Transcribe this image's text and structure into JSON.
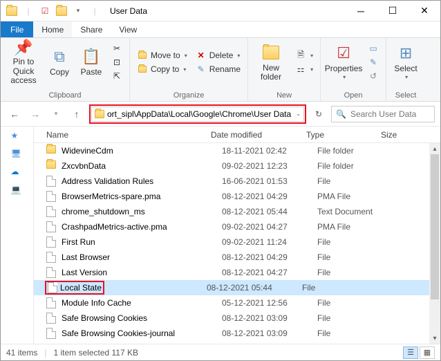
{
  "window": {
    "title": "User Data"
  },
  "menu": {
    "file": "File",
    "home": "Home",
    "share": "Share",
    "view": "View"
  },
  "ribbon": {
    "clipboard": {
      "label": "Clipboard",
      "pin": "Pin to Quick\naccess",
      "copy": "Copy",
      "paste": "Paste"
    },
    "organize": {
      "label": "Organize",
      "moveto": "Move to",
      "copyto": "Copy to",
      "delete": "Delete",
      "rename": "Rename"
    },
    "new": {
      "label": "New",
      "newfolder": "New\nfolder"
    },
    "open": {
      "label": "Open",
      "properties": "Properties"
    },
    "select": {
      "label": "Select",
      "select": "Select"
    }
  },
  "address": {
    "path": "ort_sipl\\AppData\\Local\\Google\\Chrome\\User Data"
  },
  "search": {
    "placeholder": "Search User Data"
  },
  "columns": {
    "name": "Name",
    "date": "Date modified",
    "type": "Type",
    "size": "Size"
  },
  "files": [
    {
      "icon": "folder",
      "name": "WidevineCdm",
      "date": "18-11-2021 02:42",
      "type": "File folder"
    },
    {
      "icon": "folder",
      "name": "ZxcvbnData",
      "date": "09-02-2021 12:23",
      "type": "File folder"
    },
    {
      "icon": "file",
      "name": "Address Validation Rules",
      "date": "16-06-2021 01:53",
      "type": "File"
    },
    {
      "icon": "file",
      "name": "BrowserMetrics-spare.pma",
      "date": "08-12-2021 04:29",
      "type": "PMA File"
    },
    {
      "icon": "file",
      "name": "chrome_shutdown_ms",
      "date": "08-12-2021 05:44",
      "type": "Text Document"
    },
    {
      "icon": "file",
      "name": "CrashpadMetrics-active.pma",
      "date": "09-02-2021 04:27",
      "type": "PMA File"
    },
    {
      "icon": "file",
      "name": "First Run",
      "date": "09-02-2021 11:24",
      "type": "File"
    },
    {
      "icon": "file",
      "name": "Last Browser",
      "date": "08-12-2021 04:29",
      "type": "File"
    },
    {
      "icon": "file",
      "name": "Last Version",
      "date": "08-12-2021 04:27",
      "type": "File"
    },
    {
      "icon": "file",
      "name": "Local State",
      "date": "08-12-2021 05:44",
      "type": "File",
      "selected": true,
      "highlighted": true
    },
    {
      "icon": "file",
      "name": "Module Info Cache",
      "date": "05-12-2021 12:56",
      "type": "File"
    },
    {
      "icon": "file",
      "name": "Safe Browsing Cookies",
      "date": "08-12-2021 03:09",
      "type": "File"
    },
    {
      "icon": "file",
      "name": "Safe Browsing Cookies-journal",
      "date": "08-12-2021 03:09",
      "type": "File"
    }
  ],
  "status": {
    "items": "41 items",
    "selected": "1 item selected  117 KB"
  }
}
